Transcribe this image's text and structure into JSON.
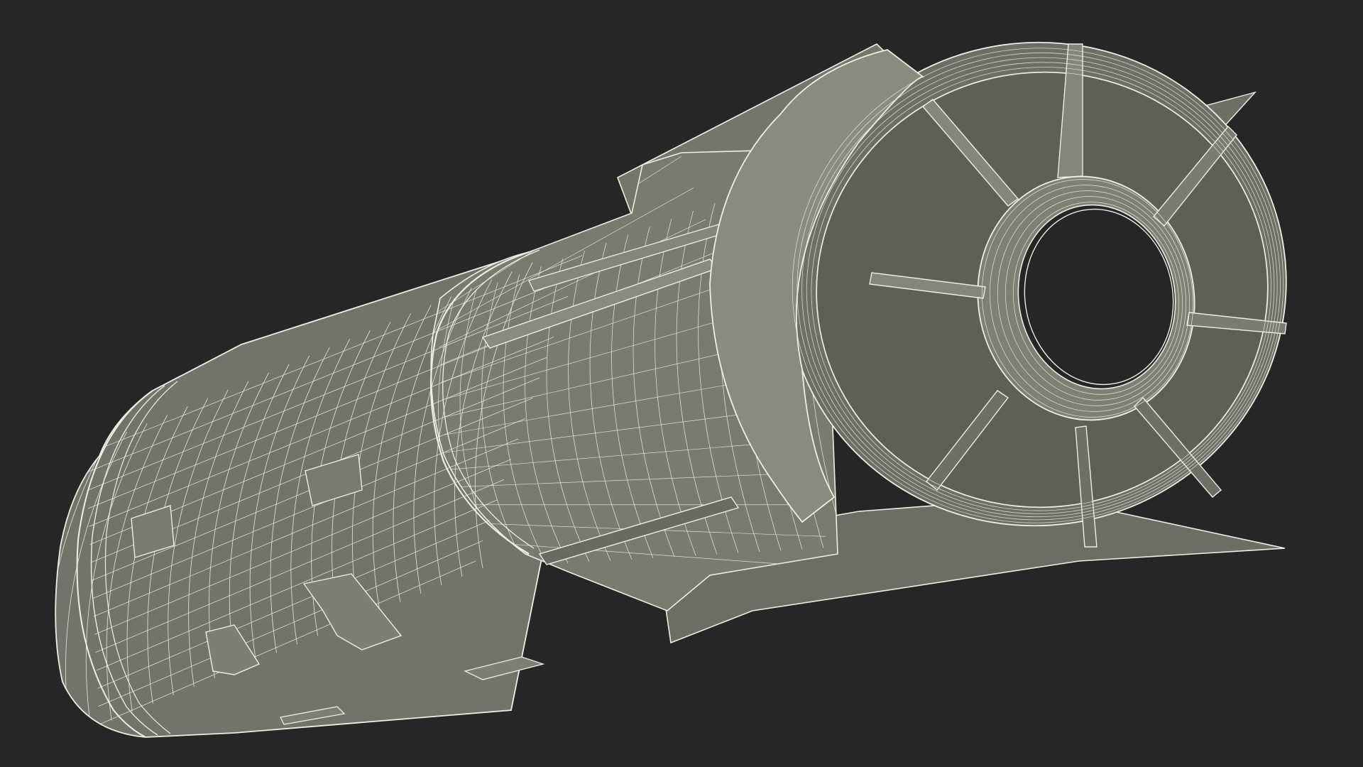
{
  "scene": {
    "subject": "bomb-wireframe-render",
    "colors": {
      "background": "#262626",
      "surface": "#727268",
      "surface_light": "#8a8a7e",
      "surface_dark": "#5e5e55",
      "hole": "#262626",
      "wire": "#eeeee4",
      "wire_dim": "#c9c9bd"
    }
  }
}
